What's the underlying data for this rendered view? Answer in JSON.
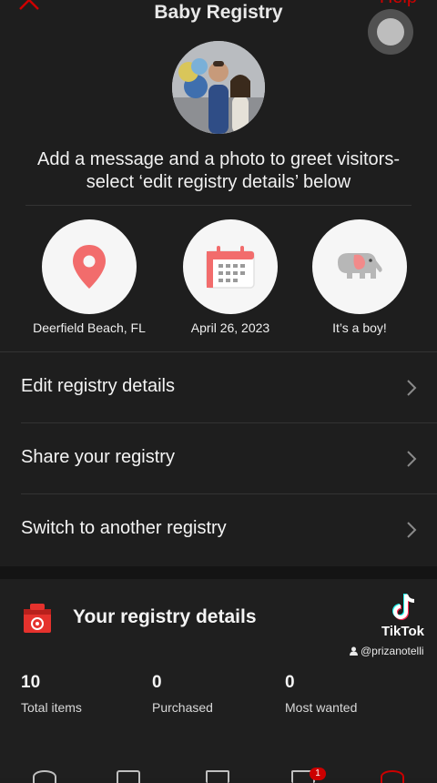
{
  "header": {
    "title": "Baby Registry",
    "help_label": "Help",
    "accent_color": "#cc0000"
  },
  "greeting": {
    "line1": "Add a message and a photo to greet visitors-",
    "line2": "select ‘edit registry details’ below"
  },
  "details": [
    {
      "icon": "location-pin-icon",
      "label": "Deerfield Beach, FL"
    },
    {
      "icon": "calendar-icon",
      "label": "April 26, 2023"
    },
    {
      "icon": "elephant-icon",
      "label": "It’s a boy!"
    }
  ],
  "menu": [
    {
      "label": "Edit registry details"
    },
    {
      "label": "Share your registry"
    },
    {
      "label": "Switch to another registry"
    }
  ],
  "stats": {
    "title": "Your registry details",
    "items": [
      {
        "value": "10",
        "label": "Total items"
      },
      {
        "value": "0",
        "label": "Purchased"
      },
      {
        "value": "0",
        "label": "Most wanted"
      }
    ]
  },
  "watermark": {
    "name": "TikTok",
    "handle": "@prizanotelli"
  },
  "tabbar": {
    "badge": "1"
  }
}
